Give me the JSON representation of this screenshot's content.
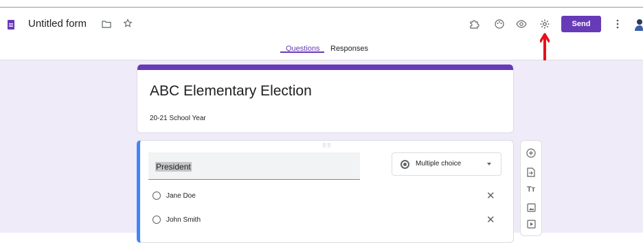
{
  "app": {
    "title": "Untitled form"
  },
  "header": {
    "send_label": "Send",
    "icons": [
      "folder-icon",
      "star-icon",
      "addon-icon",
      "palette-icon",
      "preview-icon",
      "settings-icon",
      "more-icon"
    ]
  },
  "tabs": [
    {
      "label": "Questions",
      "active": true
    },
    {
      "label": "Responses",
      "active": false
    }
  ],
  "form": {
    "title": "ABC Elementary Election",
    "description": "20-21 School Year"
  },
  "question": {
    "title": "President",
    "type": "Multiple choice",
    "options": [
      {
        "label": "Jane Doe"
      },
      {
        "label": "John Smith"
      }
    ]
  },
  "toolbar": {
    "icons": [
      "add-question-icon",
      "import-icon",
      "title-text-icon",
      "image-icon",
      "video-icon"
    ],
    "text_icon_glyph": "Tт"
  },
  "colors": {
    "accent": "#673ab7",
    "annotation_arrow": "#e3121b",
    "question_highlight": "#4285f4"
  }
}
